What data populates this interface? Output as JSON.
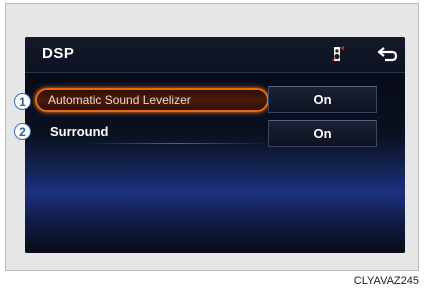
{
  "screen": {
    "title": "DSP",
    "icons": {
      "dsp": "speaker-setting-icon",
      "back": "back-arrow-icon"
    }
  },
  "rows": [
    {
      "label": "Automatic Sound Levelizer",
      "value": "On",
      "callout": "1",
      "highlighted": true
    },
    {
      "label": "Surround",
      "value": "On",
      "callout": "2",
      "highlighted": false
    }
  ],
  "colors": {
    "highlight": "#e86a10",
    "callout": "#3b6fb5"
  },
  "figure_code": "CLYAVAZ245"
}
